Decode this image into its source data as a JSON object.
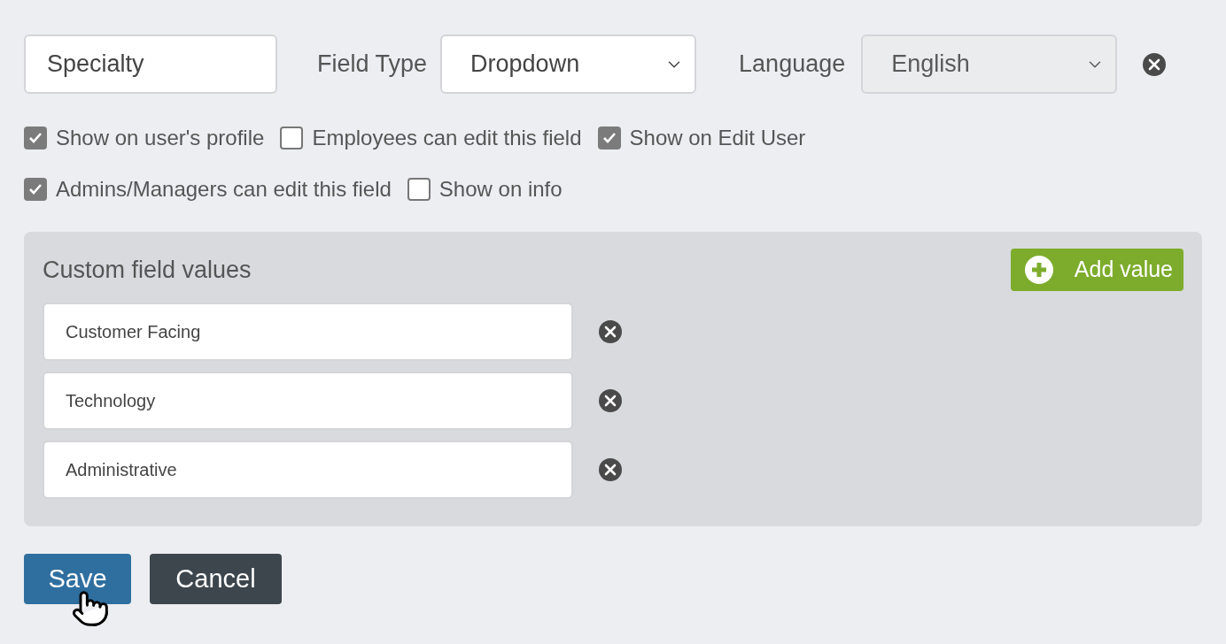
{
  "field_name": {
    "value": "Specialty"
  },
  "field_type": {
    "label": "Field Type",
    "value": "Dropdown",
    "disabled": false
  },
  "language": {
    "label": "Language",
    "value": "English",
    "disabled": true
  },
  "checkbox_rows": [
    [
      {
        "label": "Show on user's profile",
        "checked": true
      },
      {
        "label": "Employees can edit this field",
        "checked": false
      },
      {
        "label": "Show on Edit User",
        "checked": true
      }
    ],
    [
      {
        "label": "Admins/Managers can edit this field",
        "checked": true
      },
      {
        "label": "Show on info",
        "checked": false
      }
    ]
  ],
  "custom_values": {
    "title": "Custom field values",
    "add_button": "Add value",
    "values": [
      "Customer Facing",
      "Technology",
      "Administrative"
    ]
  },
  "buttons": [
    {
      "label": "Save",
      "kind": "primary"
    },
    {
      "label": "Cancel",
      "kind": "secondary"
    }
  ]
}
